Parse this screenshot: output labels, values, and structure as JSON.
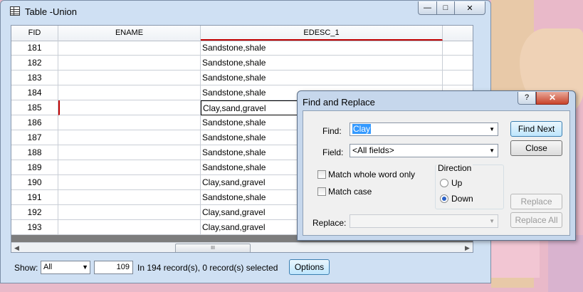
{
  "window": {
    "title": "Table -Union",
    "min_label": "—",
    "max_label": "□",
    "close_label": "✕"
  },
  "table": {
    "columns": [
      "FID",
      "ENAME",
      "EDESC_1"
    ],
    "rows": [
      {
        "fid": "181",
        "ename": "",
        "edesc": "Sandstone,shale"
      },
      {
        "fid": "182",
        "ename": "",
        "edesc": "Sandstone,shale"
      },
      {
        "fid": "183",
        "ename": "",
        "edesc": "Sandstone,shale"
      },
      {
        "fid": "184",
        "ename": "",
        "edesc": "Sandstone,shale"
      },
      {
        "fid": "185",
        "ename": "",
        "edesc": "Clay,sand,gravel"
      },
      {
        "fid": "186",
        "ename": "",
        "edesc": "Sandstone,shale"
      },
      {
        "fid": "187",
        "ename": "",
        "edesc": "Sandstone,shale"
      },
      {
        "fid": "188",
        "ename": "",
        "edesc": "Sandstone,shale"
      },
      {
        "fid": "189",
        "ename": "",
        "edesc": "Sandstone,shale"
      },
      {
        "fid": "190",
        "ename": "",
        "edesc": "Clay,sand,gravel"
      },
      {
        "fid": "191",
        "ename": "",
        "edesc": "Sandstone,shale"
      },
      {
        "fid": "192",
        "ename": "",
        "edesc": "Clay,sand,gravel"
      },
      {
        "fid": "193",
        "ename": "",
        "edesc": "Clay,sand,gravel"
      }
    ],
    "scroll_thumb_label": "III"
  },
  "status": {
    "show_label": "Show:",
    "show_value": "All",
    "record_value": "109",
    "record_text": "In 194 record(s), 0 record(s) selected",
    "options_label": "Options"
  },
  "find_dialog": {
    "title": "Find and Replace",
    "help_label": "?",
    "close_label": "✕",
    "find_label": "Find:",
    "find_value": "Clay",
    "field_label": "Field:",
    "field_value": "<All fields>",
    "match_whole_word_label": "Match whole word only",
    "match_case_label": "Match case",
    "direction_label": "Direction",
    "up_label": "Up",
    "down_label": "Down",
    "direction_selected": "Down",
    "replace_label": "Replace:",
    "replace_value": "",
    "find_next_label": "Find Next",
    "close_button_label": "Close",
    "replace_button_label": "Replace",
    "replace_all_label": "Replace All"
  }
}
